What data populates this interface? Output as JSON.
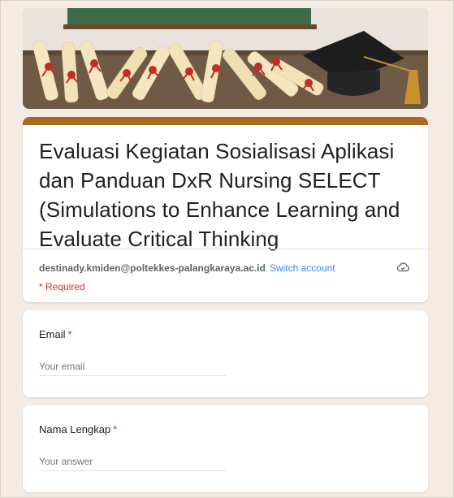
{
  "form": {
    "title": "Evaluasi Kegiatan Sosialisasi Aplikasi dan Panduan DxR Nursing SELECT (Simulations to Enhance Learning and Evaluate Critical Thinking",
    "account_email": "destinady.kmiden@poltekkes-palangkaraya.ac.id",
    "switch_account": "Switch account",
    "required_note": "* Required",
    "accent_color": "#a86a1f"
  },
  "questions": [
    {
      "label": "Email",
      "required_mark": "*",
      "placeholder": "Your email"
    },
    {
      "label": "Nama Lengkap",
      "required_mark": "*",
      "placeholder": "Your answer"
    }
  ]
}
